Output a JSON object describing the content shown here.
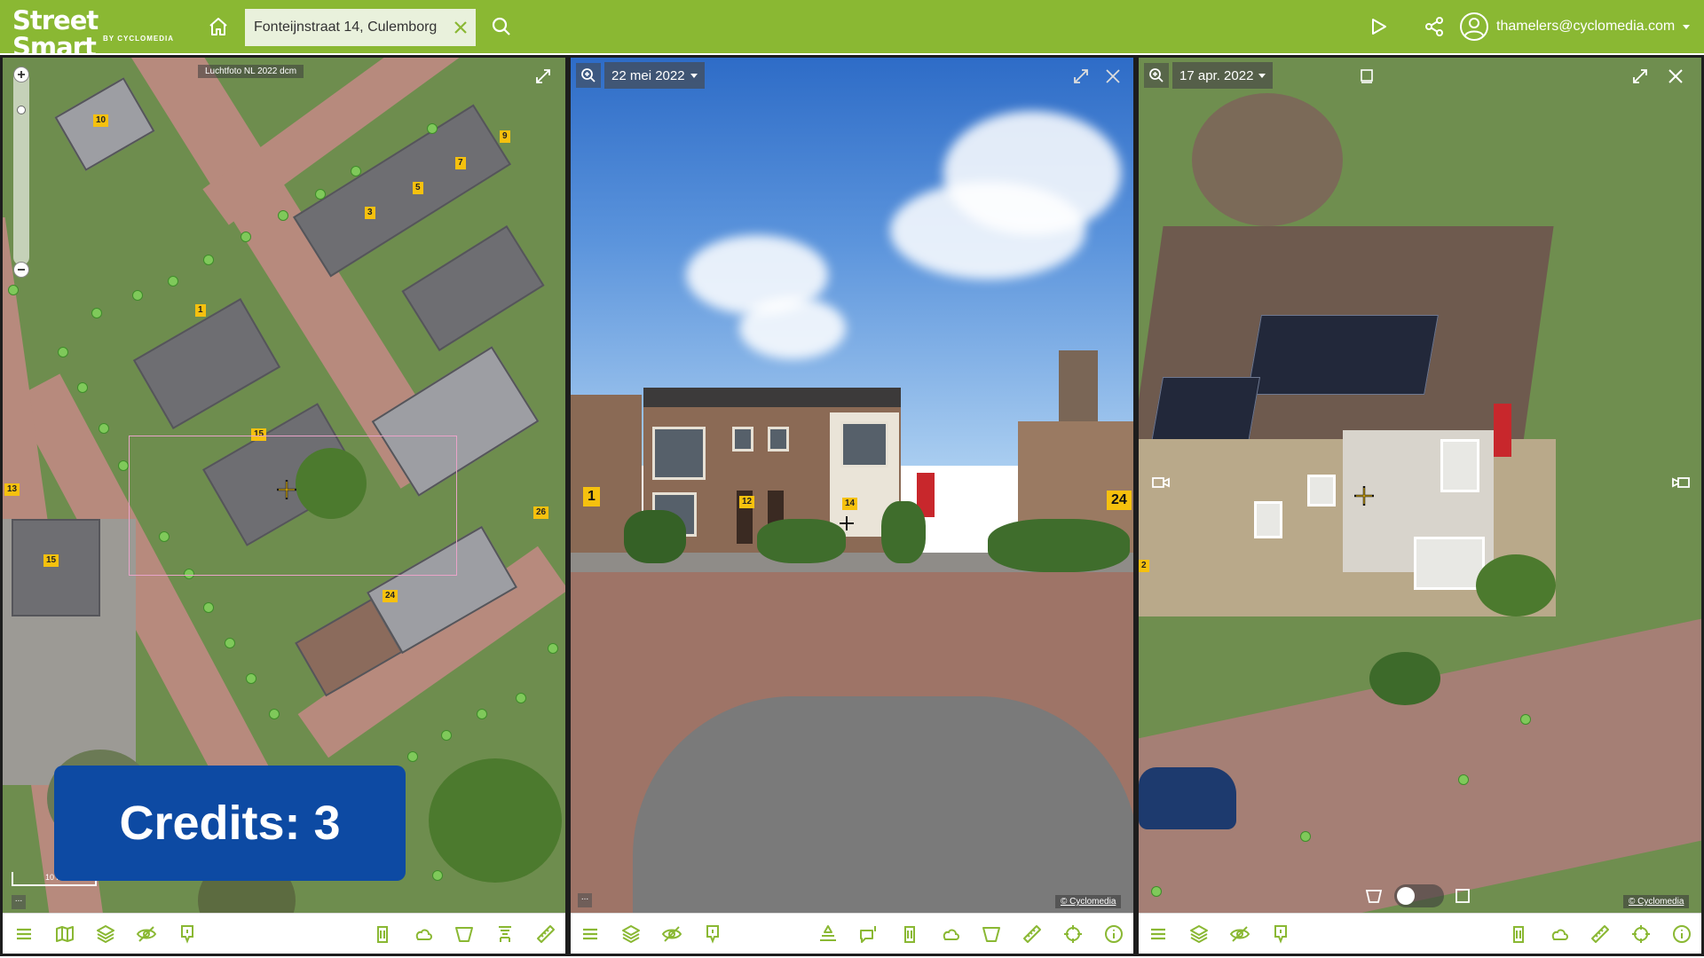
{
  "app": {
    "logo_main": "Street Smart",
    "logo_sub": "BY CYCLOMEDIA",
    "search_value": "Fonteijnstraat 14, Culemborg",
    "user_email": "thamelers@cyclomedia.com"
  },
  "colors": {
    "topbar": "#8ab833",
    "credits_bg": "#0d4aa3",
    "house_number_tag": "#f6c10e",
    "recording_point": "#7fc95a"
  },
  "map_panel": {
    "caption": "Luchtfoto NL 2022 dcm",
    "scale_label": "10 m",
    "credits_label": "Credits:",
    "credits_value": "3",
    "house_numbers": [
      "10",
      "9",
      "7",
      "5",
      "3",
      "1",
      "15",
      "13",
      "26",
      "24",
      "15"
    ],
    "ellipsis": "..."
  },
  "pano_panel": {
    "date": "22 mei 2022",
    "copyright": "© Cyclomedia",
    "house_numbers": [
      "1",
      "12",
      "14",
      "24"
    ],
    "ellipsis": "..."
  },
  "oblique_panel": {
    "date": "17 apr. 2022",
    "copyright": "© Cyclomedia",
    "house_numbers": [
      "2"
    ]
  },
  "icons": {
    "topbar": [
      "home-icon",
      "close-icon",
      "search-icon",
      "play-icon",
      "share-icon",
      "user-icon",
      "caret-down-icon"
    ],
    "map_toolbar": [
      "menu-icon",
      "map-icon",
      "layers-icon",
      "visibility-icon",
      "marker-icon",
      "trash-icon",
      "cloud-icon",
      "area-icon",
      "height-icon",
      "ruler-icon"
    ],
    "pano_toolbar": [
      "menu-icon",
      "layers-icon",
      "visibility-icon",
      "marker-icon",
      "elevation-icon",
      "comment-icon",
      "trash-icon",
      "cloud-icon",
      "area-icon",
      "ruler-icon",
      "crosshair-icon",
      "info-icon"
    ],
    "oblique_toolbar": [
      "menu-icon",
      "layers-icon",
      "visibility-icon",
      "marker-icon",
      "trash-icon",
      "cloud-icon",
      "ruler-icon",
      "crosshair-icon",
      "info-icon"
    ]
  }
}
